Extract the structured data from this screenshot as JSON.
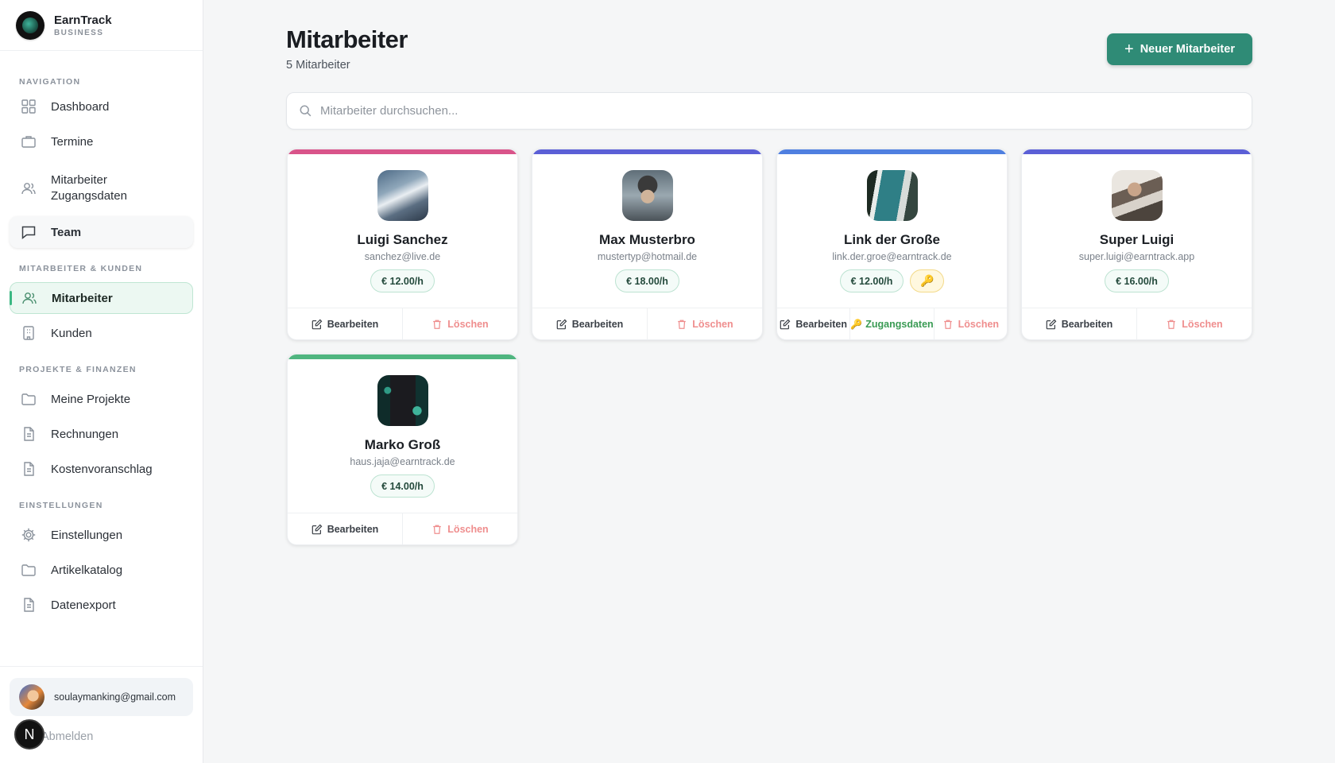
{
  "brand": {
    "name": "EarnTrack",
    "sub": "BUSINESS"
  },
  "nav": {
    "section_navigation": "NAVIGATION",
    "section_people": "MITARBEITER & KUNDEN",
    "section_projects": "PROJEKTE & FINANZEN",
    "section_settings": "EINSTELLUNGEN",
    "dashboard": "Dashboard",
    "termine": "Termine",
    "zugang_line1": "Mitarbeiter",
    "zugang_line2": "Zugangsdaten",
    "team": "Team",
    "mitarbeiter": "Mitarbeiter",
    "kunden": "Kunden",
    "projekte": "Meine Projekte",
    "rechnungen": "Rechnungen",
    "kosten": "Kostenvoranschlag",
    "einstellungen": "Einstellungen",
    "artikel": "Artikelkatalog",
    "export": "Datenexport"
  },
  "user": {
    "email": "soulaymanking@gmail.com",
    "logout": "Abmelden",
    "badge": "N"
  },
  "header": {
    "title": "Mitarbeiter",
    "count": "5 Mitarbeiter",
    "new_button": "Neuer Mitarbeiter"
  },
  "search": {
    "placeholder": "Mitarbeiter durchsuchen..."
  },
  "actions": {
    "edit": "Bearbeiten",
    "delete": "Löschen",
    "credentials": "Zugangsdaten"
  },
  "employees": [
    {
      "name": "Luigi Sanchez",
      "email": "sanchez@live.de",
      "rate": "€  12.00/h",
      "accent": "#d9548a"
    },
    {
      "name": "Max Musterbro",
      "email": "mustertyp@hotmail.de",
      "rate": "€  18.00/h",
      "accent": "#5b5fd6"
    },
    {
      "name": "Link der Große",
      "email": "link.der.groe@earntrack.de",
      "rate": "€  12.00/h",
      "accent": "#4f7fe0",
      "has_credentials": true
    },
    {
      "name": "Super Luigi",
      "email": "super.luigi@earntrack.app",
      "rate": "€  16.00/h",
      "accent": "#5b5fd6"
    },
    {
      "name": "Marko Groß",
      "email": "haus.jaja@earntrack.de",
      "rate": "€  14.00/h",
      "accent": "#4fb57f"
    }
  ]
}
